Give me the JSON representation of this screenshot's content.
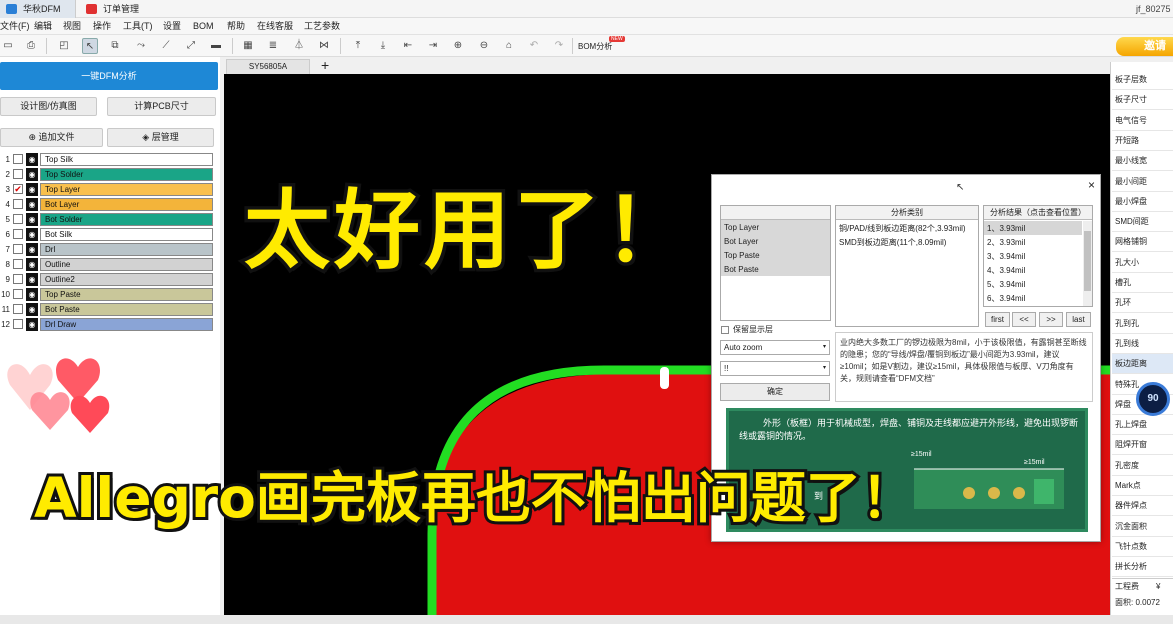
{
  "titlebar": {
    "tabs": [
      {
        "label": "华秋DFM"
      },
      {
        "label": "订单管理"
      }
    ],
    "user": "jf_80275"
  },
  "menu": [
    "文件(F)",
    "编辑",
    "视图",
    "操作",
    "工具(T)",
    "设置",
    "BOM",
    "帮助",
    "在线客服",
    "工艺参数"
  ],
  "toolbar": {
    "bom_label": "BOM分析",
    "bom_badge": "NEW",
    "invite": "邀请"
  },
  "left": {
    "dfm_button": "一键DFM分析",
    "design_sim": "设计图/仿真图",
    "calc_size": "计算PCB尺寸",
    "add_file": "追加文件",
    "layer_mgmt": "层管理",
    "layers": [
      {
        "num": "1",
        "name": "Top Silk",
        "color": "#ffffff",
        "checked": false
      },
      {
        "num": "2",
        "name": "Top Solder",
        "color": "#1aa587",
        "checked": false
      },
      {
        "num": "3",
        "name": "Top Layer",
        "color": "#f9c04d",
        "checked": true
      },
      {
        "num": "4",
        "name": "Bot Layer",
        "color": "#f3b43a",
        "checked": false
      },
      {
        "num": "5",
        "name": "Bot Solder",
        "color": "#1aa587",
        "checked": false
      },
      {
        "num": "6",
        "name": "Bot Silk",
        "color": "#ffffff",
        "checked": false
      },
      {
        "num": "7",
        "name": "Drl",
        "color": "#b9c4c9",
        "checked": false
      },
      {
        "num": "8",
        "name": "Outline",
        "color": "#d2d2d2",
        "checked": false
      },
      {
        "num": "9",
        "name": "Outline2",
        "color": "#d2d2d2",
        "checked": false
      },
      {
        "num": "10",
        "name": "Top Paste",
        "color": "#c9c79a",
        "checked": false
      },
      {
        "num": "11",
        "name": "Bot Paste",
        "color": "#c9c79a",
        "checked": false
      },
      {
        "num": "12",
        "name": "Drl Draw",
        "color": "#8aa4d6",
        "checked": false
      }
    ]
  },
  "doc_tab": "SY56805A",
  "dialog": {
    "layers": [
      "Top Layer",
      "Bot Layer",
      "Top Paste",
      "Bot Paste"
    ],
    "category_header": "分析类别",
    "categories": [
      "铜/PAD/线到板边距离(82个,3.93mil)",
      "SMD到板边距离(11个,8.09mil)"
    ],
    "result_header": "分析结果（点击查看位置）",
    "results": [
      "1、3.93mil",
      "2、3.93mil",
      "3、3.94mil",
      "4、3.94mil",
      "5、3.94mil",
      "6、3.94mil"
    ],
    "nav": [
      "first",
      "<<",
      ">>",
      "last"
    ],
    "keep_layer": "保留显示层",
    "zoom": "Auto zoom",
    "second_select": "!!",
    "confirm": "确定",
    "description": "业内绝大多数工厂的锣边极限为8mil，小于该极限值，有露铜甚至断线的隐患；您的“导线/焊盘/覆铜到板边”最小间距为3.93mil，建议≥10mil；如是V割边，建议≥15mil，具体极限值与板厚、V刀角度有关，规则请查看“DFM文档”",
    "info": "外形（板框）用于机械成型，焊盘、铺铜及走线都应避开外形线，避免出现锣断线或露铜的情况。",
    "info_labels": [
      "≥15mil",
      "≥15mil"
    ],
    "info_partial": [
      "用。",
      "到"
    ]
  },
  "right": {
    "items": [
      "板子层数",
      "板子尺寸",
      "电气信号",
      "开短路",
      "最小线宽",
      "最小间距",
      "最小焊盘",
      "SMD间距",
      "网格铺铜",
      "孔大小",
      "槽孔",
      "孔环",
      "孔到孔",
      "孔到线",
      "板边距离",
      "特殊孔",
      "焊盘",
      "孔上焊盘",
      "阻焊开窗",
      "孔密度",
      "Mark点",
      "器件焊点",
      "沉金面积",
      "飞针点数",
      "拼长分析"
    ],
    "price_label": "工程费",
    "price_value": "¥",
    "area": "面积: 0.0072",
    "timer": "90"
  },
  "overlay": {
    "headline": "太好用了！",
    "subline": "Allegro画完板再也不怕出问题了！"
  }
}
